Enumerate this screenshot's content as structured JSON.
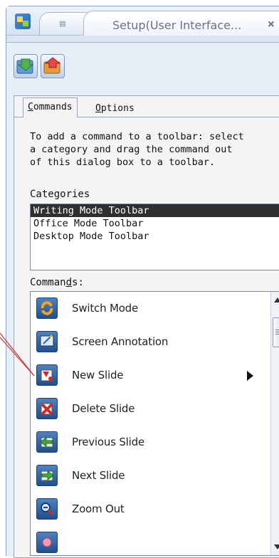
{
  "window": {
    "tab_title": "Setup(User Interface...",
    "close_glyph": "×"
  },
  "dialog": {
    "tabs": [
      {
        "label_first": "C",
        "label_rest": "ommands"
      },
      {
        "label_first": "O",
        "label_rest": "ptions"
      }
    ],
    "instructions": "To add a command to a toolbar: select\na category and drag the command out\nof this dialog box to a toolbar.",
    "categories_label": "Categories",
    "categories": [
      "Writing Mode Toolbar",
      "Office Mode Toolbar",
      "Desktop Mode Toolbar"
    ],
    "selected_category_index": 0,
    "commands_label_pre": "Comman",
    "commands_label_ul": "d",
    "commands_label_post": "s:",
    "commands": [
      {
        "label": "Switch Mode",
        "icon": "switch-mode-icon"
      },
      {
        "label": "Screen Annotation",
        "icon": "screen-annotation-icon"
      },
      {
        "label": "New Slide",
        "icon": "new-slide-icon",
        "has_submenu": true
      },
      {
        "label": "Delete Slide",
        "icon": "delete-slide-icon"
      },
      {
        "label": "Previous Slide",
        "icon": "previous-slide-icon"
      },
      {
        "label": "Next Slide",
        "icon": "next-slide-icon"
      },
      {
        "label": "Zoom Out",
        "icon": "zoom-out-icon"
      }
    ]
  },
  "colors": {
    "selection": "#2f2f2f",
    "callout": "#d0343a",
    "window_bg": "#dbe6f3"
  }
}
